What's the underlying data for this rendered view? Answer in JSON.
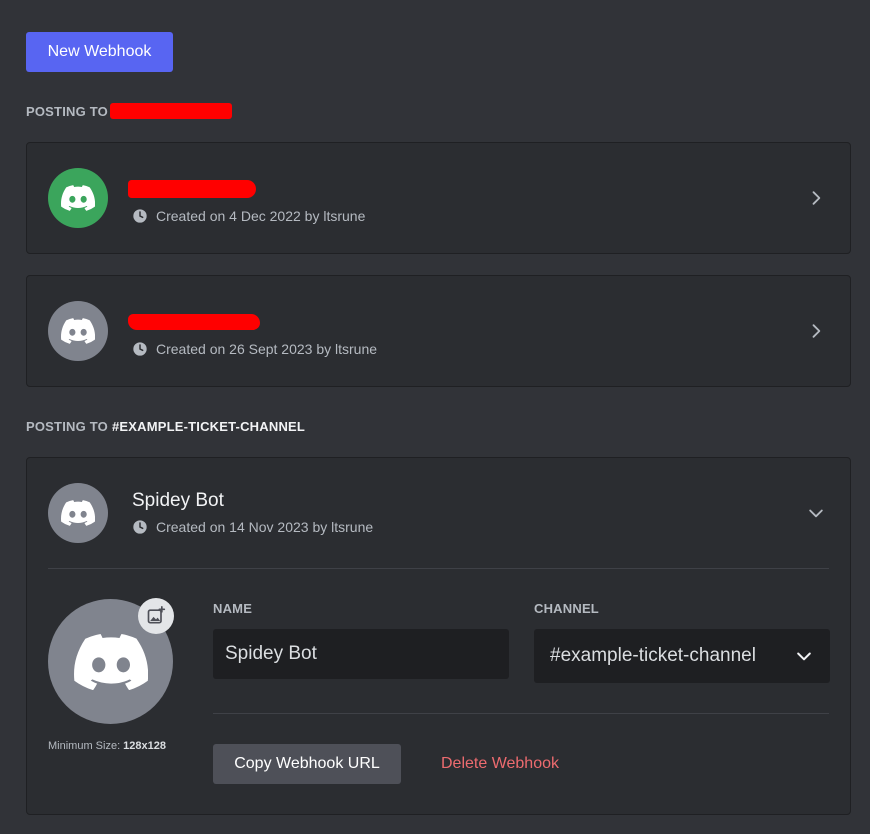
{
  "toolbar": {
    "new_webhook_label": "New Webhook"
  },
  "sections": [
    {
      "heading": "POSTING TO",
      "channel": "",
      "webhooks": [
        {
          "name": "",
          "created": "Created on 4 Dec 2022 by ltsrune",
          "avatar_color": "#3ba55c"
        },
        {
          "name": "",
          "created": "Created on 26 Sept 2023 by ltsrune",
          "avatar_color": "#80848e"
        }
      ]
    },
    {
      "heading": "POSTING TO",
      "channel": "#EXAMPLE-TICKET-CHANNEL",
      "webhooks": [
        {
          "name": "Spidey Bot",
          "created": "Created on 14 Nov 2023 by ltsrune",
          "avatar_color": "#80848e",
          "expanded": true,
          "edit": {
            "name_label": "NAME",
            "name_value": "Spidey Bot",
            "channel_label": "CHANNEL",
            "channel_value": "#example-ticket-channel",
            "min_size_label": "Minimum Size:",
            "min_size_value": "128x128",
            "copy_url_label": "Copy Webhook URL",
            "delete_label": "Delete Webhook"
          }
        }
      ]
    }
  ],
  "icons": {
    "avatar": "discord-logo-icon",
    "meta": "clock-icon",
    "collapsed": "chevron-right-icon",
    "expanded": "chevron-down-icon",
    "upload": "image-add-icon"
  },
  "colors": {
    "brand": "#5865f2",
    "background": "#313338",
    "card": "#2b2d31",
    "danger": "#ed6b6f"
  }
}
